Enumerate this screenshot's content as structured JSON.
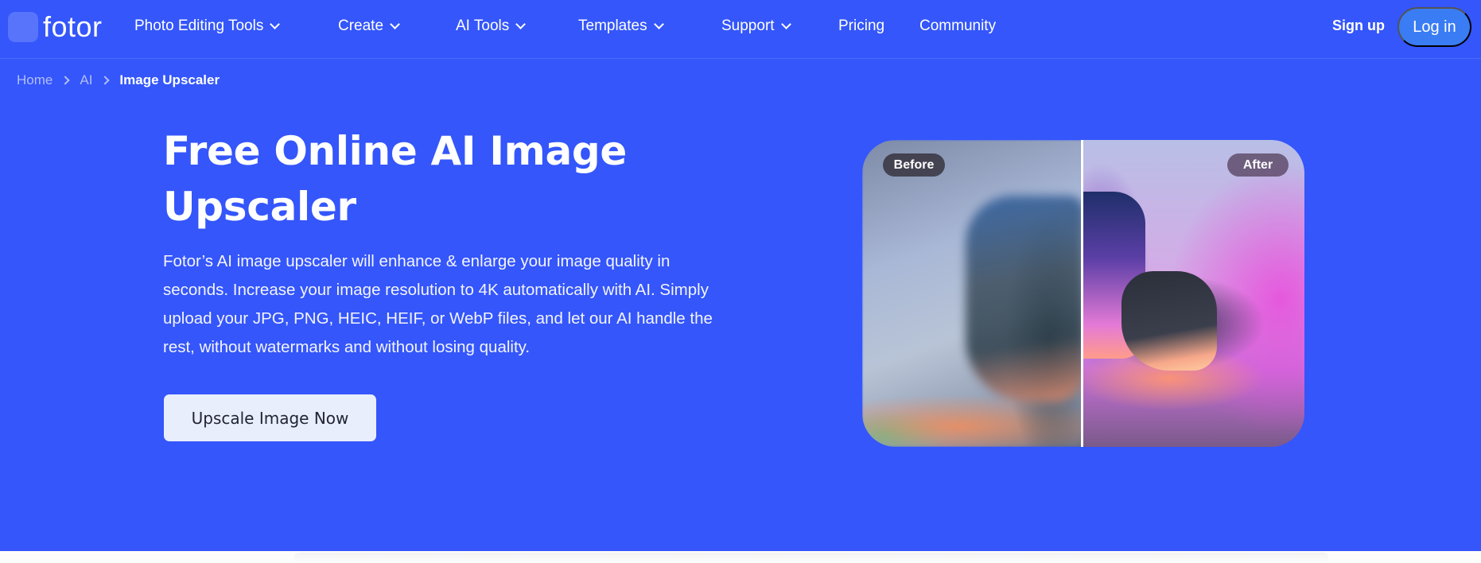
{
  "brand": {
    "name": "fotor",
    "accent": "#3456fb",
    "login_bg": "#3a7cf4"
  },
  "nav": {
    "items": [
      {
        "label": "Photo Editing Tools",
        "has_dropdown": true
      },
      {
        "label": "Create",
        "has_dropdown": true
      },
      {
        "label": "AI Tools",
        "has_dropdown": true
      },
      {
        "label": "Templates",
        "has_dropdown": true
      },
      {
        "label": "Support",
        "has_dropdown": true
      },
      {
        "label": "Pricing",
        "has_dropdown": false
      },
      {
        "label": "Community",
        "has_dropdown": false
      }
    ],
    "signup_label": "Sign up",
    "login_label": "Log in"
  },
  "breadcrumb": {
    "items": [
      "Home",
      "AI"
    ],
    "current": "Image Upscaler"
  },
  "hero": {
    "title": "Free Online AI Image Upscaler",
    "description": "Fotor’s AI image upscaler will enhance & enlarge your image quality in seconds. Increase your image resolution to 4K automatically with AI. Simply upload your JPG, PNG, HEIC, HEIF, or WebP files, and let our AI handle the rest, without watermarks and without losing quality.",
    "cta_label": "Upscale Image Now"
  },
  "comparison": {
    "before_label": "Before",
    "after_label": "After",
    "image_subject": "sneaker photo before/after upscaling"
  }
}
